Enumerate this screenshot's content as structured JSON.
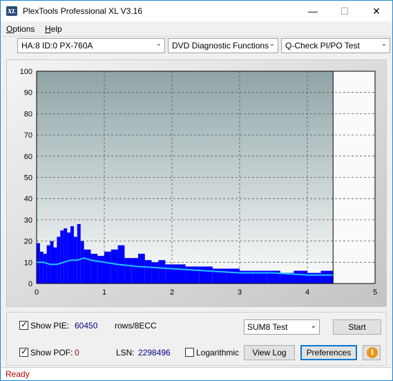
{
  "window": {
    "title": "PlexTools Professional XL V3.16",
    "icon_label": "XL",
    "minimize_glyph": "—",
    "maximize_glyph": "☐",
    "close_glyph": "✕"
  },
  "menu": {
    "items": [
      {
        "label": "Options",
        "accel": "O",
        "rest": "ptions"
      },
      {
        "label": "Help",
        "accel": "H",
        "rest": "elp"
      }
    ]
  },
  "toolbar": {
    "drive": "HA:8 ID:0  PX-760A",
    "function": "DVD Diagnostic Functions",
    "test": "Q-Check PI/PO Test"
  },
  "chart_data": {
    "type": "area",
    "x_ticks": [
      "0",
      "1",
      "2",
      "3",
      "4",
      "5"
    ],
    "y_ticks": [
      "0",
      "10",
      "20",
      "30",
      "40",
      "50",
      "60",
      "70",
      "80",
      "90",
      "100"
    ],
    "xlim": [
      0,
      5
    ],
    "ylim": [
      0,
      100
    ],
    "grid": true,
    "end_marker_x": 4.38,
    "series": [
      {
        "kind": "bars",
        "color": "#0000ff",
        "x": [
          0.0,
          0.05,
          0.1,
          0.15,
          0.2,
          0.25,
          0.3,
          0.35,
          0.4,
          0.45,
          0.5,
          0.55,
          0.6,
          0.65,
          0.7,
          0.8,
          0.9,
          1.0,
          1.1,
          1.2,
          1.3,
          1.4,
          1.5,
          1.6,
          1.7,
          1.8,
          1.9,
          2.0,
          2.2,
          2.4,
          2.6,
          2.8,
          3.0,
          3.2,
          3.4,
          3.6,
          3.8,
          4.0,
          4.2,
          4.38
        ],
        "y": [
          19,
          15,
          14,
          18,
          20,
          17,
          22,
          25,
          26,
          24,
          27,
          22,
          28,
          20,
          16,
          14,
          13,
          15,
          16,
          18,
          12,
          12,
          14,
          11,
          10,
          11,
          9,
          9,
          8,
          8,
          7,
          7,
          6,
          6,
          6,
          5,
          6,
          5,
          6,
          5
        ]
      },
      {
        "kind": "line",
        "color": "#20c8ff",
        "x": [
          0.0,
          0.1,
          0.2,
          0.3,
          0.4,
          0.5,
          0.6,
          0.7,
          0.8,
          1.0,
          1.2,
          1.5,
          2.0,
          2.5,
          3.0,
          3.5,
          4.0,
          4.38
        ],
        "y": [
          10,
          10,
          9,
          9,
          10,
          11,
          11,
          12,
          11,
          10,
          9,
          8,
          7,
          6,
          5,
          5,
          4,
          4
        ]
      }
    ]
  },
  "panel": {
    "show_pie_label": "Show PIE:",
    "show_pie_checked": true,
    "pie_value": "60450",
    "rows_label": "rows/8ECC",
    "show_pof_label": "Show POF:",
    "show_pof_checked": true,
    "pof_value": "0",
    "lsn_label": "LSN:",
    "lsn_value": "2298496",
    "logarithmic_label": "Logarithmic",
    "logarithmic_checked": false,
    "test_select": "SUM8 Test",
    "start_label": "Start",
    "view_log_label": "View Log",
    "preferences_label": "Preferences",
    "info_glyph": "i",
    "check_glyph": "✓",
    "dropdown_glyph": "⌄"
  },
  "status": {
    "text": "Ready"
  },
  "colors": {
    "pie_value": "#00008b",
    "pof_value": "#c00000",
    "lsn_value": "#00008b",
    "status": "#c00000"
  }
}
